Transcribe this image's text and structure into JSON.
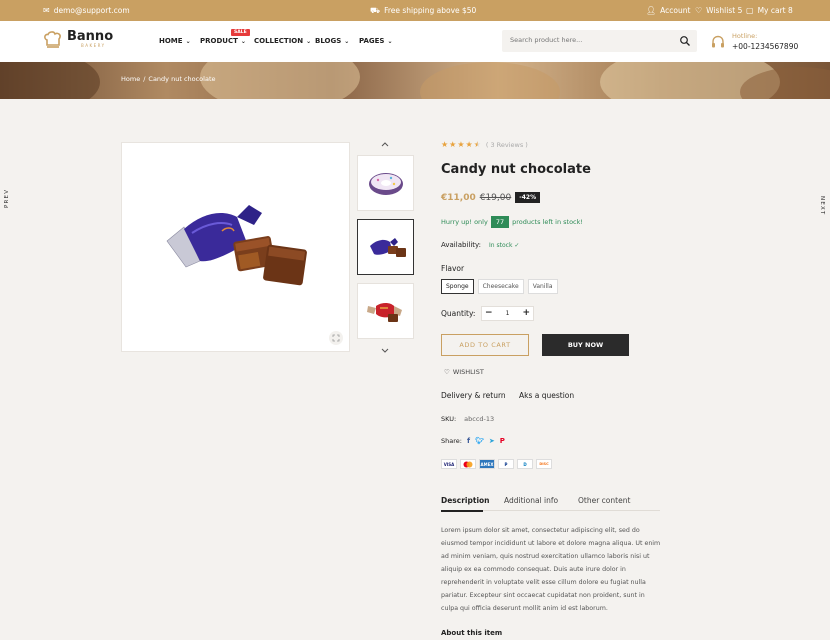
{
  "topbar": {
    "email": "demo@support.com",
    "shipping": "Free shipping above $50",
    "account": "Account",
    "wishlist": "Wishlist 5",
    "cart": "My cart 8"
  },
  "header": {
    "logo_name": "Banno",
    "logo_sub": "BAKERY",
    "nav": [
      {
        "label": "HOME"
      },
      {
        "label": "PRODUCT",
        "badge": "SALE"
      },
      {
        "label": "COLLECTION"
      },
      {
        "label": "BLOGS"
      },
      {
        "label": "PAGES"
      }
    ],
    "search_placeholder": "Search product here...",
    "hotline_label": "Hotline:",
    "hotline_number": "+00-1234567890"
  },
  "breadcrumb": {
    "home": "Home",
    "separator": "/",
    "current": "Candy nut chocolate"
  },
  "side": {
    "prev": "PREV",
    "next": "NEXT"
  },
  "product": {
    "rating": 4.5,
    "reviews": "( 3 Reviews )",
    "title": "Candy nut chocolate",
    "price_new": "€11,00",
    "price_old": "€19,00",
    "discount": "-42%",
    "hurry_before": "Hurry up! only",
    "stock_count": "77",
    "hurry_after": "products left in stock!",
    "availability_label": "Availability:",
    "availability_value": "In stock",
    "flavor_label": "Flavor",
    "flavors": [
      "Sponge",
      "Cheesecake",
      "Vanilla"
    ],
    "selected_flavor": "Sponge",
    "quantity_label": "Quantity:",
    "quantity": "1",
    "add_to_cart": "ADD TO CART",
    "buy_now": "BUY NOW",
    "wishlist": "WISHLIST",
    "delivery": "Delivery & return",
    "ask": "Aks a question",
    "sku_label": "SKU:",
    "sku_value": "abccd-13",
    "share_label": "Share:",
    "payments": [
      "VISA",
      "MC",
      "AMEX",
      "P",
      "D",
      "DISC"
    ]
  },
  "tabs": {
    "description": "Description",
    "additional": "Additional info",
    "other": "Other content",
    "description_text": "Lorem ipsum dolor sit amet, consectetur adipiscing elit, sed do eiusmod tempor incididunt ut labore et dolore magna aliqua. Ut enim ad minim veniam, quis nostrud exercitation ullamco laboris nisi ut aliquip ex ea commodo consequat. Duis aute irure dolor in reprehenderit in voluptate velit esse cillum dolore eu fugiat nulla pariatur. Excepteur sint occaecat cupidatat non proident, sunt in culpa qui officia deserunt mollit anim id est laborum.",
    "about": "About this item"
  },
  "colors": {
    "accent": "#c9a062",
    "stock_green": "#2e8b57",
    "dark_button": "#2b2b2b"
  }
}
